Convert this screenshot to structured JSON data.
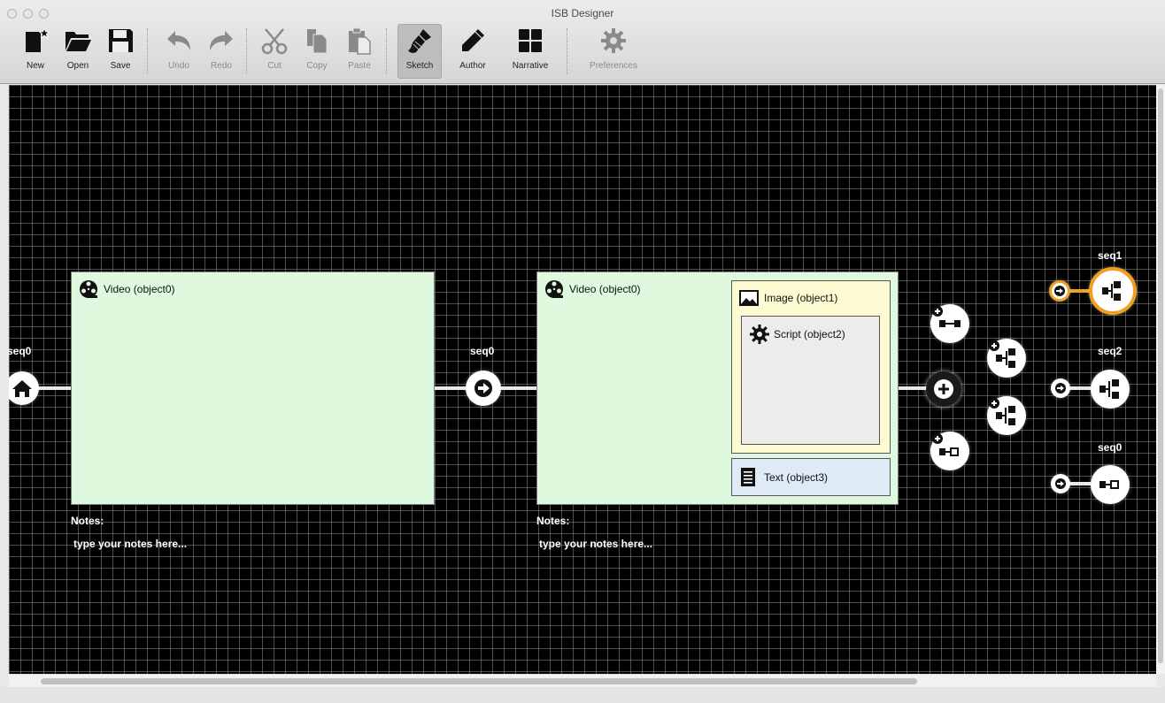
{
  "window": {
    "title": "ISB Designer"
  },
  "toolbar": {
    "new": "New",
    "open": "Open",
    "save": "Save",
    "undo": "Undo",
    "redo": "Redo",
    "cut": "Cut",
    "copy": "Copy",
    "paste": "Paste",
    "sketch": "Sketch",
    "author": "Author",
    "narrative": "Narrative",
    "preferences": "Preferences"
  },
  "canvas": {
    "left_seq": "seq0",
    "middle_seq": "seq0",
    "scene1": {
      "video": "Video (object0)",
      "notes_title": "Notes:",
      "notes_value": "type your notes here..."
    },
    "scene2": {
      "video": "Video (object0)",
      "image": "Image (object1)",
      "script": "Script (object2)",
      "text": "Text (object3)",
      "notes_title": "Notes:",
      "notes_value": "type your notes here..."
    },
    "sequences": [
      {
        "label": "seq1",
        "selected": true
      },
      {
        "label": "seq2",
        "selected": false
      },
      {
        "label": "seq0",
        "selected": false
      }
    ]
  },
  "colors": {
    "scene_bg": "#dff9df",
    "image_bg": "#fdfbd2",
    "text_bg": "#dfeaf7",
    "selected": "#f0a020"
  }
}
